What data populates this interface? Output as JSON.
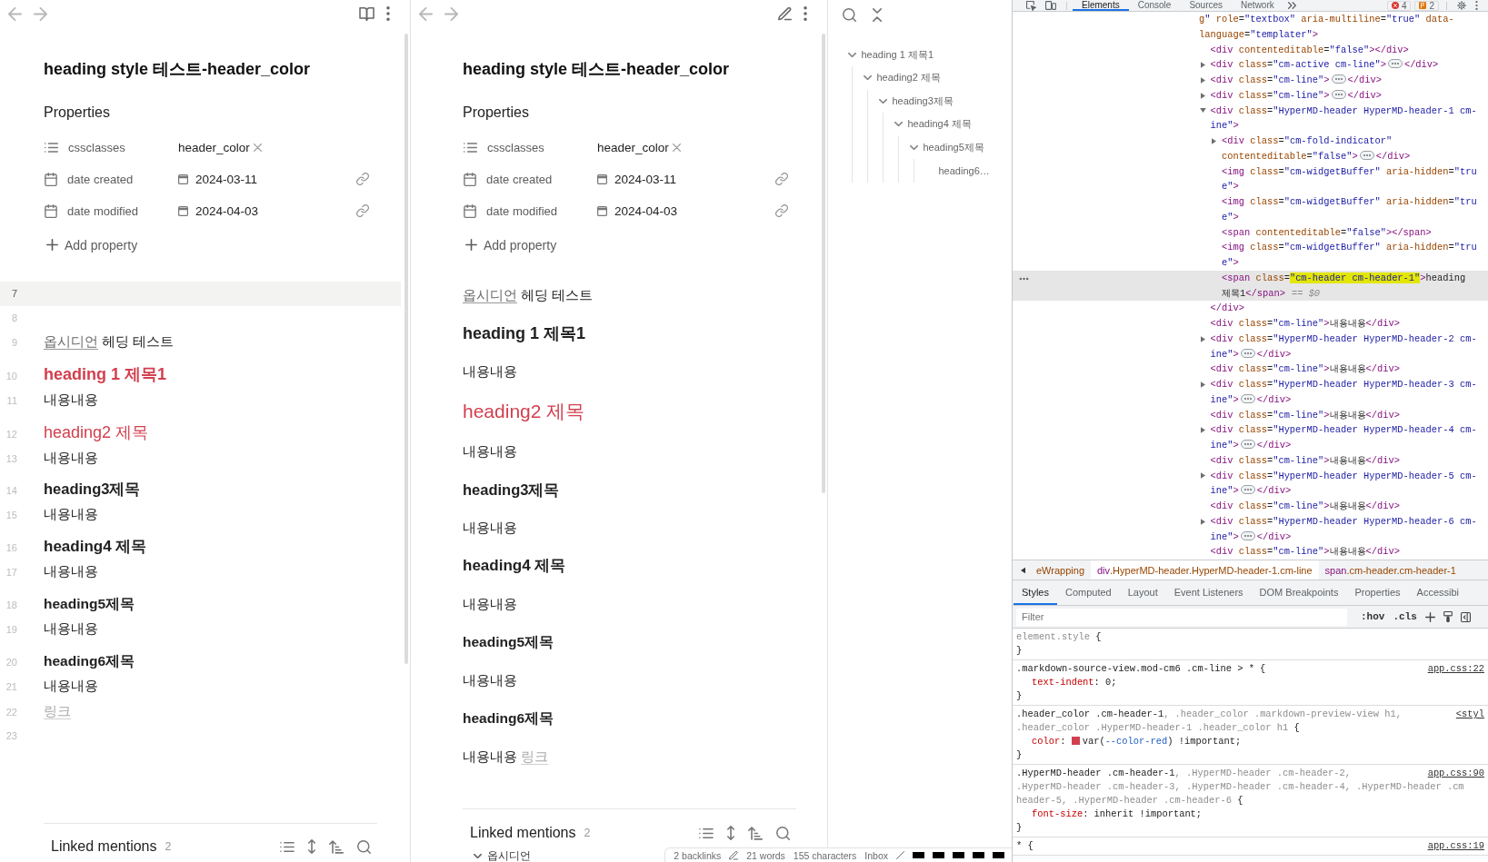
{
  "panes": [
    {
      "kind": "source",
      "title": "heading style 테스트-header_color",
      "properties": {
        "heading": "Properties",
        "items": [
          {
            "kind": "list",
            "name": "cssclasses",
            "tags": [
              "header_color"
            ]
          },
          {
            "kind": "date",
            "name": "date created",
            "value": "2024-03-11"
          },
          {
            "kind": "date",
            "name": "date modified",
            "value": "2024-04-03"
          }
        ],
        "add_label": "Add property"
      },
      "blocks": [
        {
          "number": "7",
          "kind": "blank",
          "active": true
        },
        {
          "number": "8",
          "kind": "blank",
          "active": false
        },
        {
          "number": "9",
          "kind": "text",
          "active": false,
          "parts": [
            {
              "kind": "link",
              "text": "옵시디언",
              "resolved": true
            },
            {
              "kind": "text",
              "text": " 헤딩 테스트"
            }
          ]
        },
        {
          "number": "10",
          "kind": "h1",
          "active": false,
          "text": "heading 1 제목1",
          "color": "#d2404f"
        },
        {
          "number": "11",
          "kind": "text",
          "active": false,
          "parts": [
            {
              "kind": "text",
              "text": "내용내용"
            }
          ]
        },
        {
          "number": "12",
          "kind": "h2",
          "active": false,
          "text": "heading2 제목",
          "color": "#d2404f"
        },
        {
          "number": "13",
          "kind": "text",
          "active": false,
          "parts": [
            {
              "kind": "text",
              "text": "내용내용"
            }
          ]
        },
        {
          "number": "14",
          "kind": "h3",
          "active": false,
          "text": "heading3제목",
          "color": "#222222"
        },
        {
          "number": "15",
          "kind": "text",
          "active": false,
          "parts": [
            {
              "kind": "text",
              "text": "내용내용"
            }
          ]
        },
        {
          "number": "16",
          "kind": "h4",
          "active": false,
          "text": "heading4 제목",
          "color": "#222222"
        },
        {
          "number": "17",
          "kind": "text",
          "active": false,
          "parts": [
            {
              "kind": "text",
              "text": "내용내용"
            }
          ]
        },
        {
          "number": "18",
          "kind": "h5",
          "active": false,
          "text": "heading5제목",
          "color": "#222222"
        },
        {
          "number": "19",
          "kind": "text",
          "active": false,
          "parts": [
            {
              "kind": "text",
              "text": "내용내용"
            }
          ]
        },
        {
          "number": "20",
          "kind": "h6",
          "active": false,
          "text": "heading6제목",
          "color": "#222222"
        },
        {
          "number": "21",
          "kind": "text",
          "active": false,
          "parts": [
            {
              "kind": "text",
              "text": "내용내용"
            }
          ]
        },
        {
          "number": "22",
          "kind": "text",
          "active": false,
          "parts": [
            {
              "kind": "link",
              "text": "링크",
              "resolved": false
            }
          ]
        },
        {
          "number": "23",
          "kind": "blank",
          "active": false
        }
      ],
      "linked_mentions": {
        "label": "Linked mentions",
        "count": "2"
      }
    },
    {
      "kind": "reading",
      "title": "heading style 테스트-header_color",
      "properties": {
        "heading": "Properties",
        "items": [
          {
            "kind": "list",
            "name": "cssclasses",
            "tags": [
              "header_color"
            ]
          },
          {
            "kind": "date",
            "name": "date created",
            "value": "2024-03-11"
          },
          {
            "kind": "date",
            "name": "date modified",
            "value": "2024-04-03"
          }
        ],
        "add_label": "Add property"
      },
      "blocks": [
        {
          "kind": "text",
          "parts": [
            {
              "kind": "link",
              "text": "옵시디언",
              "resolved": true
            },
            {
              "kind": "text",
              "text": " 헤딩 테스트"
            }
          ]
        },
        {
          "kind": "h1",
          "text": "heading 1 제목1",
          "color": "#222222"
        },
        {
          "kind": "text",
          "parts": [
            {
              "kind": "text",
              "text": "내용내용"
            }
          ]
        },
        {
          "kind": "h2",
          "text": "heading2 제목",
          "color": "#d2404f"
        },
        {
          "kind": "text",
          "parts": [
            {
              "kind": "text",
              "text": "내용내용"
            }
          ]
        },
        {
          "kind": "h3",
          "text": "heading3제목",
          "color": "#222222"
        },
        {
          "kind": "text",
          "parts": [
            {
              "kind": "text",
              "text": "내용내용"
            }
          ]
        },
        {
          "kind": "h4",
          "text": "heading4 제목",
          "color": "#222222"
        },
        {
          "kind": "text",
          "parts": [
            {
              "kind": "text",
              "text": "내용내용"
            }
          ]
        },
        {
          "kind": "h5",
          "text": "heading5제목",
          "color": "#222222"
        },
        {
          "kind": "text",
          "parts": [
            {
              "kind": "text",
              "text": "내용내용"
            }
          ]
        },
        {
          "kind": "h6",
          "text": "heading6제목",
          "color": "#222222"
        },
        {
          "kind": "text",
          "parts": [
            {
              "kind": "text",
              "text": "내용내용 "
            },
            {
              "kind": "link",
              "text": "링크",
              "resolved": false
            }
          ]
        }
      ],
      "linked_mentions": {
        "label": "Linked mentions",
        "count": "2",
        "items": [
          {
            "text": "옵시디언",
            "expanded": true
          }
        ]
      }
    }
  ],
  "outline": {
    "items": [
      {
        "text": "heading 1 제목1",
        "expanded": true,
        "children": [
          {
            "text": "heading2 제목",
            "expanded": true,
            "children": [
              {
                "text": "heading3제목",
                "expanded": true,
                "children": [
                  {
                    "text": "heading4 제목",
                    "expanded": true,
                    "children": [
                      {
                        "text": "heading5제목",
                        "expanded": true,
                        "children": [
                          {
                            "text": "heading6…"
                          }
                        ]
                      }
                    ]
                  }
                ]
              }
            ]
          }
        ]
      }
    ]
  },
  "status_bar": {
    "backlinks": "2 backlinks",
    "word_count": "21 words",
    "character_count": "155 characters",
    "status_text": "Inbox"
  },
  "devtools": {
    "tabs": [
      {
        "label": "Elements",
        "selected": true
      },
      {
        "label": "Console",
        "selected": false
      },
      {
        "label": "Sources",
        "selected": false
      },
      {
        "label": "Network",
        "selected": false
      }
    ],
    "error_count": "4",
    "warning_count": "2",
    "dom_tree": {
      "selected": false,
      "lines": [
        "g\" role=\"textbox\" aria-multiline=\"true\" data-",
        "language=\"templater\">"
      ],
      "children": [
        {
          "selected": false,
          "lines": [
            "<div contenteditable=\"false\"></div>"
          ]
        },
        {
          "selected": false,
          "expanded": false,
          "lines": [
            "<div class=\"cm-active cm-line\">"
          ],
          "close": "</div>"
        },
        {
          "selected": false,
          "expanded": false,
          "lines": [
            "<div class=\"cm-line\">"
          ],
          "close": "</div>"
        },
        {
          "selected": false,
          "expanded": false,
          "lines": [
            "<div class=\"cm-line\">"
          ],
          "close": "</div>"
        },
        {
          "selected": false,
          "expanded": true,
          "lines": [
            "<div class=\"HyperMD-header HyperMD-header-1 cm-",
            "ine\">"
          ],
          "close": "</div>",
          "children": [
            {
              "selected": false,
              "expanded": false,
              "lines": [
                "<div class=\"cm-fold-indicator\"",
                "contenteditable=\"false\">"
              ],
              "close": "</div>"
            },
            {
              "selected": false,
              "lines": [
                "<img class=\"cm-widgetBuffer\" aria-hidden=\"tru",
                "e\">"
              ]
            },
            {
              "selected": false,
              "lines": [
                "<img class=\"cm-widgetBuffer\" aria-hidden=\"tru",
                "e\">"
              ]
            },
            {
              "selected": false,
              "lines": [
                "<span contenteditable=\"false\"></span>"
              ]
            },
            {
              "selected": false,
              "lines": [
                "<img class=\"cm-widgetBuffer\" aria-hidden=\"tru",
                "e\">"
              ]
            },
            {
              "selected": true,
              "lines": [
                [
                  {
                    "text": "<span class=",
                    "highlighted": false
                  },
                  {
                    "text": "\"cm-header cm-header-1\"",
                    "highlighted": true
                  },
                  {
                    "text": ">heading",
                    "highlighted": false
                  }
                ],
                "제목1</span>"
              ],
              "marker": "== $0"
            }
          ]
        },
        {
          "selected": false,
          "lines": [
            "<div class=\"cm-line\">내용내용</div>"
          ]
        },
        {
          "selected": false,
          "expanded": false,
          "lines": [
            "<div class=\"HyperMD-header HyperMD-header-2 cm-",
            "ine\">"
          ],
          "close": "</div>"
        },
        {
          "selected": false,
          "lines": [
            "<div class=\"cm-line\">내용내용</div>"
          ]
        },
        {
          "selected": false,
          "expanded": false,
          "lines": [
            "<div class=\"HyperMD-header HyperMD-header-3 cm-",
            "ine\">"
          ],
          "close": "</div>"
        },
        {
          "selected": false,
          "lines": [
            "<div class=\"cm-line\">내용내용</div>"
          ]
        },
        {
          "selected": false,
          "expanded": false,
          "lines": [
            "<div class=\"HyperMD-header HyperMD-header-4 cm-",
            "ine\">"
          ],
          "close": "</div>"
        },
        {
          "selected": false,
          "lines": [
            "<div class=\"cm-line\">내용내용</div>"
          ]
        },
        {
          "selected": false,
          "expanded": false,
          "lines": [
            "<div class=\"HyperMD-header HyperMD-header-5 cm-",
            "ine\">"
          ],
          "close": "</div>"
        },
        {
          "selected": false,
          "lines": [
            "<div class=\"cm-line\">내용내용</div>"
          ]
        },
        {
          "selected": false,
          "expanded": false,
          "lines": [
            "<div class=\"HyperMD-header HyperMD-header-6 cm-",
            "ine\">"
          ],
          "close": "</div>"
        },
        {
          "selected": false,
          "lines": [
            "<div class=\"cm-line\">내용내용</div>"
          ]
        }
      ]
    },
    "breadcrumbs": [
      {
        "text": "eWrapping",
        "highlighted": false
      },
      {
        "tag": "div",
        "text": ".HyperMD-header.HyperMD-header-1.cm-line",
        "highlighted": true
      },
      {
        "tag": "span",
        "text": ".cm-header.cm-header-1",
        "highlighted": false
      }
    ],
    "style_tabs": [
      {
        "label": "Styles",
        "selected": true
      },
      {
        "label": "Computed",
        "selected": false
      },
      {
        "label": "Layout",
        "selected": false
      },
      {
        "label": "Event Listeners",
        "selected": false
      },
      {
        "label": "DOM Breakpoints",
        "selected": false
      },
      {
        "label": "Properties",
        "selected": false
      },
      {
        "label": "Accessibi",
        "selected": false
      }
    ],
    "filter": {
      "placeholder": "Filter"
    },
    "hover_toggle": ":hov",
    "class_toggle": ".cls",
    "rules": [
      {
        "selector": [
          [
            {
              "text": "element.style",
              "dimmed": true
            },
            {
              "text": " {",
              "dimmed": false
            }
          ]
        ],
        "close": "}"
      },
      {
        "source": "app.css:22",
        "selector": [
          [
            {
              "text": ".markdown-source-view.mod-cm6 .cm-line > * {",
              "dimmed": false
            }
          ]
        ],
        "declarations": [
          {
            "text": "text-indent: 0;"
          }
        ],
        "close": "}"
      },
      {
        "source": "<styl",
        "selector": [
          [
            {
              "text": ".header_color .cm-header-1",
              "dimmed": false
            },
            {
              "text": ", .header_color .markdown-preview-view h1,",
              "dimmed": true
            }
          ],
          [
            {
              "text": ".header_color .HyperMD-header-1 .header_color h1",
              "dimmed": true
            },
            {
              "text": " {",
              "dimmed": false
            }
          ]
        ],
        "declarations": [
          {
            "text": "color: var(--color-red) !important;",
            "color": "#d2404f"
          }
        ],
        "close": "}"
      },
      {
        "source": "app.css:90",
        "selector": [
          [
            {
              "text": ".HyperMD-header .cm-header-1",
              "dimmed": false
            },
            {
              "text": ", .HyperMD-header .cm-header-2,",
              "dimmed": true
            }
          ],
          [
            {
              "text": ".HyperMD-header .cm-header-3, .HyperMD-header .cm-header-4, .HyperMD-header .cm",
              "dimmed": true
            }
          ],
          [
            {
              "text": "header-5, .HyperMD-header .cm-header-6",
              "dimmed": true
            },
            {
              "text": " {",
              "dimmed": false
            }
          ]
        ],
        "declarations": [
          {
            "text": "font-size: inherit !important;"
          }
        ],
        "close": "}"
      },
      {
        "source": "app.css:19",
        "selector": [
          [
            {
              "text": "* {",
              "dimmed": false
            }
          ]
        ]
      }
    ]
  }
}
